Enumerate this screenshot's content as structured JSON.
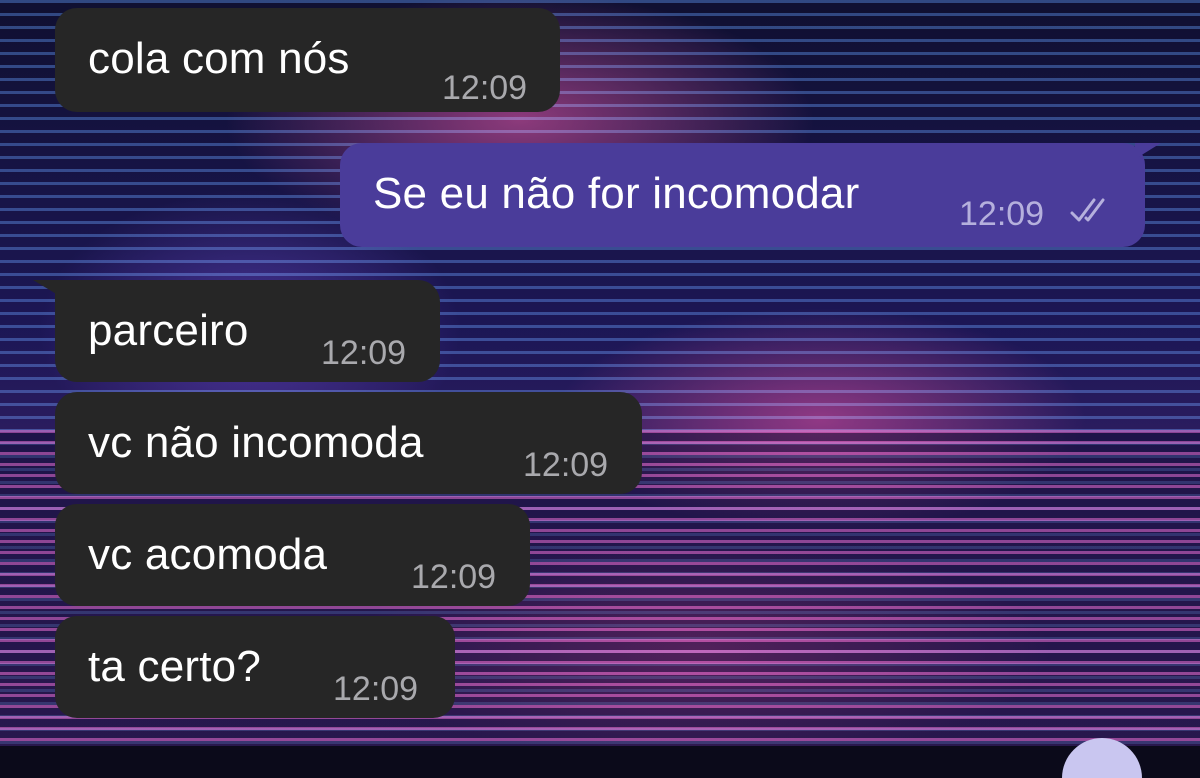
{
  "messages": [
    {
      "text": "cola com nós",
      "time": "12:09",
      "direction": "incoming"
    },
    {
      "text": "Se eu não for incomodar",
      "time": "12:09",
      "direction": "outgoing",
      "status": "read",
      "status_icon": "double-check-icon"
    },
    {
      "text": "parceiro",
      "time": "12:09",
      "direction": "incoming"
    },
    {
      "text": "vc não incomoda",
      "time": "12:09",
      "direction": "incoming"
    },
    {
      "text": "vc acomoda",
      "time": "12:09",
      "direction": "incoming"
    },
    {
      "text": "ta certo?",
      "time": "12:09",
      "direction": "incoming"
    }
  ],
  "colors": {
    "incoming_bubble": "#262626",
    "outgoing_bubble": "#4a3c9a",
    "timestamp": "#a9a9ad"
  }
}
